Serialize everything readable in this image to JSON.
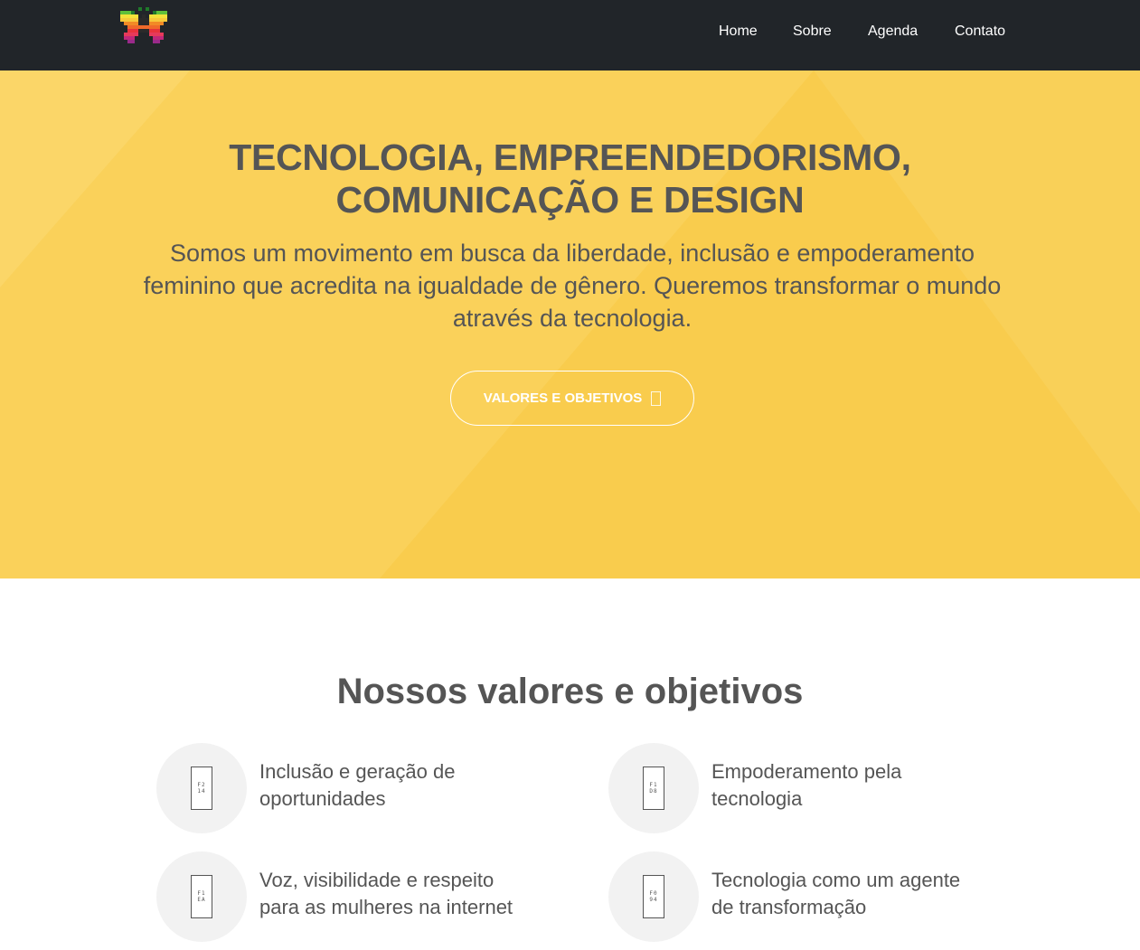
{
  "navbar": {
    "logo_alt": "butterfly-logo",
    "links": [
      {
        "label": "Home"
      },
      {
        "label": "Sobre"
      },
      {
        "label": "Agenda"
      },
      {
        "label": "Contato"
      }
    ]
  },
  "hero": {
    "title_line1": "TECNOLOGIA, EMPREENDEDORISMO,",
    "title_line2": "COMUNICAÇÃO E DESIGN",
    "subtitle": "Somos um movimento em busca da liberdade, inclusão e empoderamento feminino que acredita na igualdade de gênero. Queremos transformar o mundo através da tecnologia.",
    "button_label": "VALORES E OBJETIVOS",
    "button_icon": "arrow-down-icon",
    "background_color": "#f9cc4d"
  },
  "values": {
    "title": "Nossos valores e objetivos",
    "items": [
      {
        "text": "Inclusão e geração de oportunidades",
        "icon": "users-icon",
        "glyph": "F2\n14"
      },
      {
        "text": "Empoderamento pela tecnologia",
        "icon": "power-icon",
        "glyph": "F1\nD8"
      },
      {
        "text": "Voz, visibilidade e respeito para as mulheres na internet",
        "icon": "bullhorn-icon",
        "glyph": "F1\nEA"
      },
      {
        "text": "Tecnologia como um agente de transformação",
        "icon": "refresh-icon",
        "glyph": "F0\n94"
      }
    ]
  },
  "colors": {
    "navbar": "#212529",
    "hero": "#f9cc4d",
    "text": "#555555",
    "circle": "#f2f2f2"
  }
}
